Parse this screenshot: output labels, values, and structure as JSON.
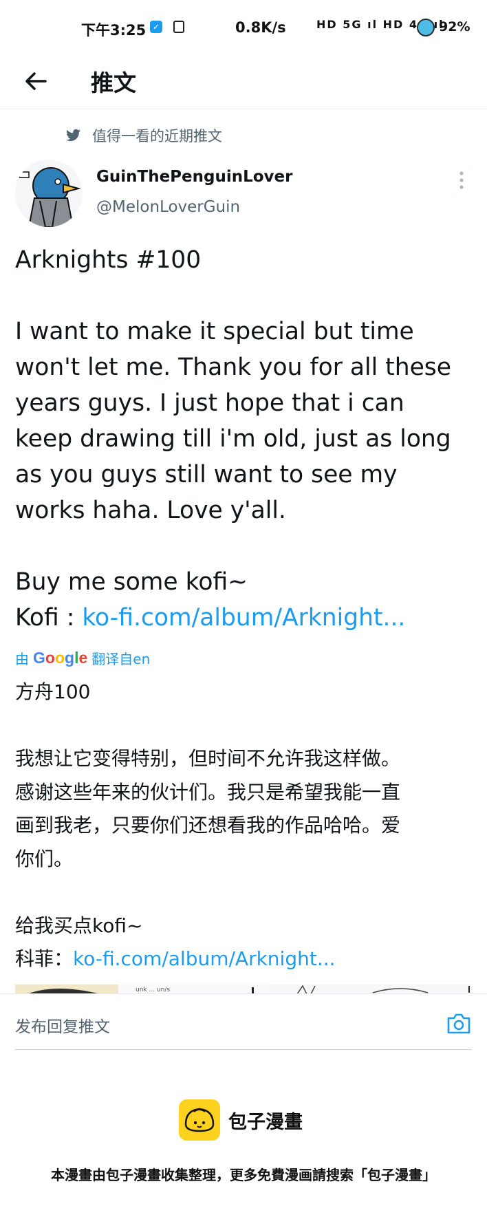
{
  "status_bar": {
    "time": "下午3:25",
    "net_speed": "0.8K/s",
    "signal_icons": "HD 5G ıl HD 4G ıl",
    "battery": "92%"
  },
  "header": {
    "title": "推文"
  },
  "pinned_label": "值得一看的近期推文",
  "author": {
    "display_name": "GuinThePenguinLover",
    "handle": "@MelonLoverGuin"
  },
  "tweet": {
    "title_line": "Arknights #100",
    "body_lines": [
      "I want to make it special but time",
      "won't let me. Thank you for all these",
      "years guys. I just hope that i can",
      "keep drawing till i'm old, just as long",
      "as you guys still want to see my",
      "works haha. Love y'all."
    ],
    "kofi_line": "Buy me some kofi~",
    "kofi_prefix": "Kofi : ",
    "kofi_link": "ko-fi.com/album/Arknight..."
  },
  "translation": {
    "by": "由",
    "google_word": "Google",
    "from": "翻译自en",
    "title_line": "方舟100",
    "body_lines": [
      "我想让它变得特别，但时间不允许我这样做。",
      "感谢这些年来的伙计们。我只是希望我能一直",
      "画到我老，只要你们还想看我的作品哈哈。爱",
      "你们。"
    ],
    "kofi_line": "给我买点kofi~",
    "kofi_prefix": "科菲：",
    "kofi_link": "ko-fi.com/album/Arknight..."
  },
  "reply": {
    "placeholder": "发布回复推文"
  },
  "brand": {
    "name": "包子漫畫"
  },
  "footer": "本漫畫由包子漫畫收集整理，更多免費漫画請搜索「包子漫畫」",
  "colors": {
    "link": "#1d9bf0",
    "secondary_text": "#536471",
    "brand_yellow": "#ffd21f"
  },
  "icons": [
    "back-arrow-icon",
    "twitter-bird-icon",
    "more-vertical-icon",
    "camera-icon",
    "battery-icon"
  ]
}
